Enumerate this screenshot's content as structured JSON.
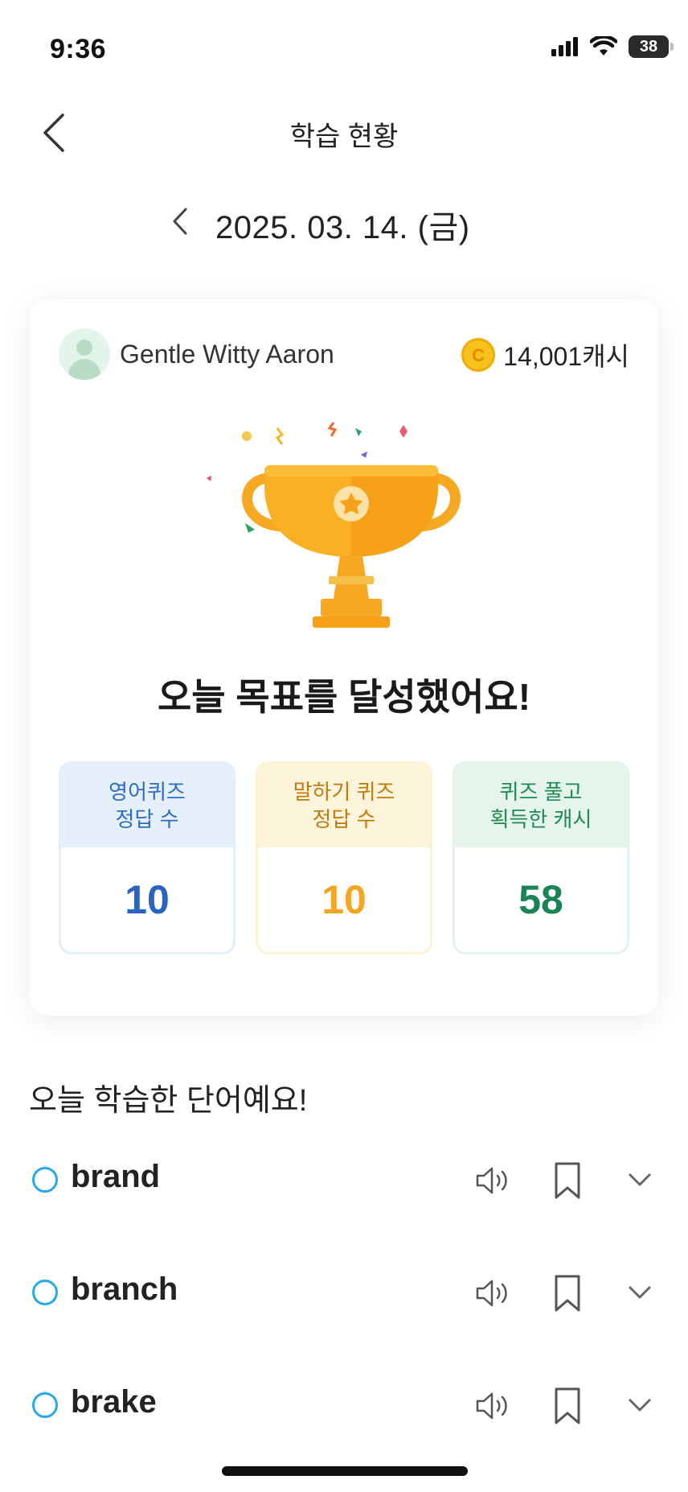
{
  "status_bar": {
    "time": "9:36",
    "battery": "38"
  },
  "header": {
    "title": "학습 현황"
  },
  "date_nav": {
    "date": "2025. 03. 14. (금)"
  },
  "summary": {
    "user_name": "Gentle Witty Aaron",
    "cash": "14,001캐시",
    "goal_message": "오늘 목표를 달성했어요!",
    "stats": [
      {
        "label": "영어퀴즈\n정답 수",
        "value": "10"
      },
      {
        "label": "말하기 퀴즈\n정답 수",
        "value": "10"
      },
      {
        "label": "퀴즈 풀고\n획득한 캐시",
        "value": "58"
      }
    ]
  },
  "words_section": {
    "title": "오늘 학습한 단어예요!",
    "items": [
      {
        "word": "brand"
      },
      {
        "word": "branch"
      },
      {
        "word": "brake"
      }
    ]
  },
  "colors": {
    "accent_blue": "#2b63c0",
    "accent_yellow": "#f5a623",
    "accent_green": "#1a8454",
    "trophy": "#f7a823",
    "radio_outline": "#2aa7e6"
  }
}
